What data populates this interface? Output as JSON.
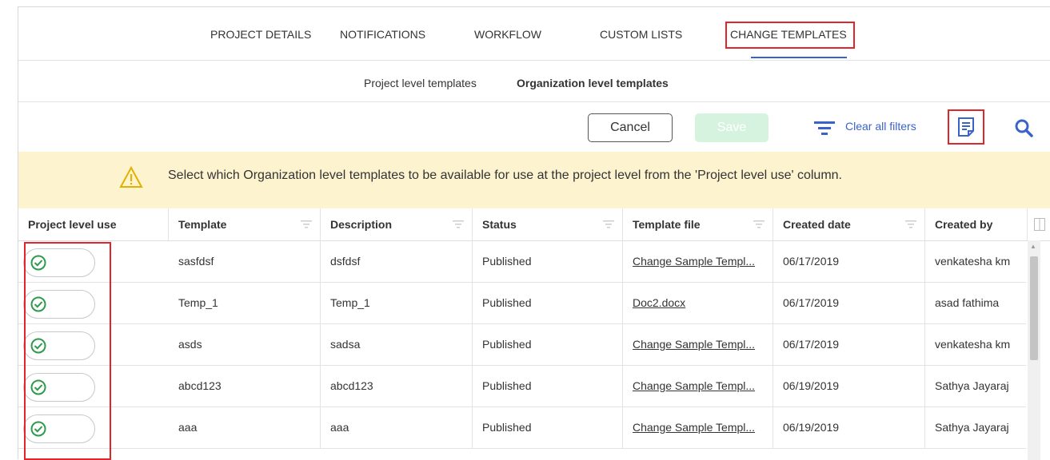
{
  "tabs": [
    {
      "label": "PROJECT DETAILS"
    },
    {
      "label": "NOTIFICATIONS"
    },
    {
      "label": "WORKFLOW"
    },
    {
      "label": "CUSTOM LISTS"
    },
    {
      "label": "CHANGE TEMPLATES",
      "active": true
    }
  ],
  "subtabs": [
    {
      "label": "Project level templates"
    },
    {
      "label": "Organization level templates",
      "active": true
    }
  ],
  "toolbar": {
    "cancel_label": "Cancel",
    "save_label": "Save",
    "clear_filters_label": "Clear all filters",
    "icons": [
      "filter-icon",
      "document-icon",
      "search-icon"
    ]
  },
  "banner": {
    "icon": "warning-icon",
    "text": "Select which Organization level templates to be available for use at the project level from the 'Project level use' column."
  },
  "table": {
    "columns": [
      "Project level use",
      "Template",
      "Description",
      "Status",
      "Template file",
      "Created date",
      "Created by"
    ],
    "rows": [
      {
        "enabled": true,
        "template": "sasfdsf",
        "description": "dsfdsf",
        "status": "Published",
        "file": "Change Sample Templ...",
        "created_date": "06/17/2019",
        "created_by": "venkatesha km"
      },
      {
        "enabled": true,
        "template": "Temp_1",
        "description": "Temp_1",
        "status": "Published",
        "file": "Doc2.docx",
        "created_date": "06/17/2019",
        "created_by": "asad fathima"
      },
      {
        "enabled": true,
        "template": "asds",
        "description": "sadsa",
        "status": "Published",
        "file": "Change Sample Templ...",
        "created_date": "06/17/2019",
        "created_by": "venkatesha km"
      },
      {
        "enabled": true,
        "template": "abcd123",
        "description": "abcd123",
        "status": "Published",
        "file": "Change Sample Templ...",
        "created_date": "06/19/2019",
        "created_by": "Sathya Jayaraj"
      },
      {
        "enabled": true,
        "template": "aaa",
        "description": "aaa",
        "status": "Published",
        "file": "Change Sample Templ...",
        "created_date": "06/19/2019",
        "created_by": "Sathya Jayaraj"
      }
    ]
  },
  "colors": {
    "accent": "#3a63c9",
    "highlight": "#e0262b",
    "banner_bg": "#fdf3cf",
    "toggle_check": "#2e9a4a",
    "save_disabled": "#d6f3df"
  }
}
